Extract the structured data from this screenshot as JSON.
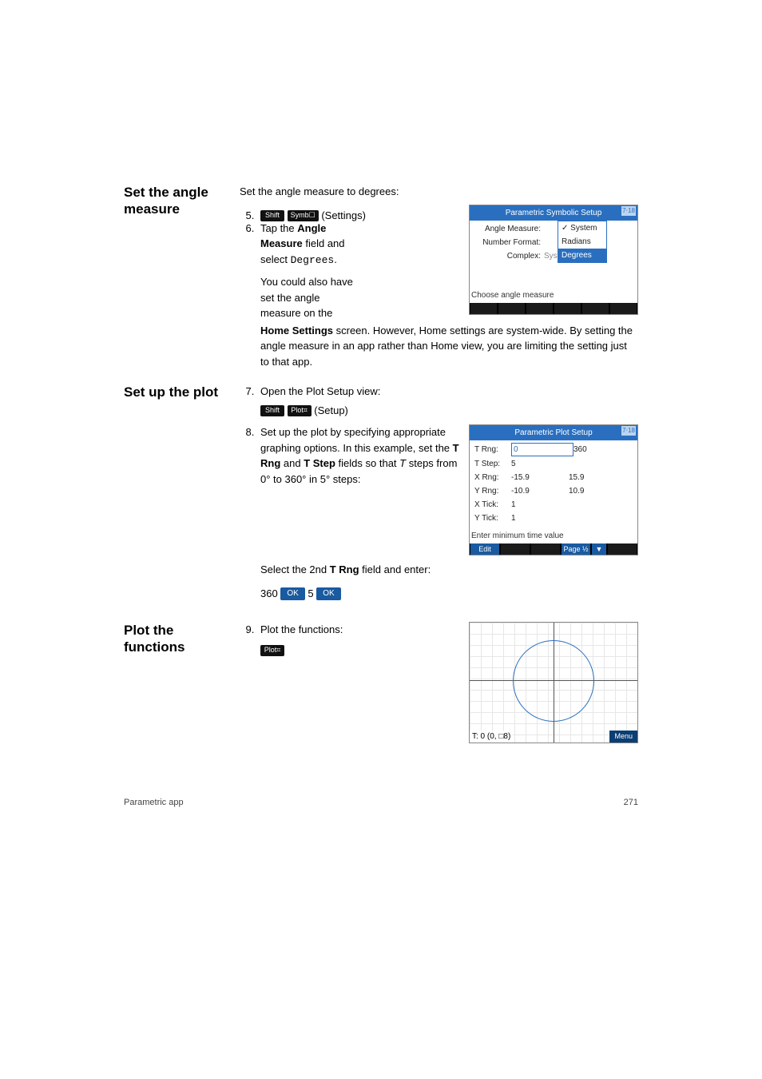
{
  "sections": {
    "angle": {
      "heading": "Set the angle measure",
      "intro": "Set the angle measure to degrees:",
      "step5": {
        "num": "5.",
        "label": "(Settings)",
        "key_shift": "Shift",
        "key_symb": "Symb☐"
      },
      "step6": {
        "num": "6.",
        "line1a": "Tap the ",
        "line1b": "Angle Measure",
        "line1c": " field and select ",
        "line1d": "Degrees",
        "line1e": ".",
        "para2a": "You could also have set the angle measure on the ",
        "para2b": "Home Settings",
        "para2c": " screen. However, Home settings are system-wide. By setting the angle measure in an app rather than Home view, you are limiting the setting just to that app."
      },
      "screenshot": {
        "title": "Parametric Symbolic Setup",
        "clock": "7⋅18",
        "rows": {
          "r1": "Angle Measure:",
          "r2": "Number Format:",
          "r3": "Complex:"
        },
        "dropdown": {
          "opt1": "System",
          "opt2": "Radians",
          "opt3": "Degrees"
        },
        "val_text": "System",
        "help": "Choose angle measure"
      }
    },
    "plot_setup": {
      "heading": "Set up the plot",
      "step7": {
        "num": "7.",
        "text": "Open the Plot Setup view:",
        "key_shift": "Shift",
        "key_plot": "Plot⌗",
        "label": "(Setup)"
      },
      "step8": {
        "num": "8.",
        "text_a": "Set up the plot by specifying appropriate graphing options. In this example, set the ",
        "text_b": "T Rng",
        "text_c": " and ",
        "text_d": "T Step",
        "text_e": " fields so that ",
        "text_f": "T",
        "text_g": " steps from 0° to 360° in 5° steps:",
        "select_a": "Select the 2nd ",
        "select_b": "T Rng",
        "select_c": " field ",
        "select_d": "and enter:",
        "entry_1": "360",
        "entry_ok": "OK",
        "entry_2": "5"
      },
      "screenshot": {
        "title": "Parametric Plot Setup",
        "clock": "7⋅18",
        "rows": {
          "r1l": "T Rng:",
          "r1v1": "0",
          "r1v2": "360",
          "r2l": "T Step:",
          "r2v1": "5",
          "r3l": "X Rng:",
          "r3v1": "-15.9",
          "r3v2": "15.9",
          "r4l": "Y Rng:",
          "r4v1": "-10.9",
          "r4v2": "10.9",
          "r5l": "X Tick:",
          "r5v1": "1",
          "r6l": "Y Tick:",
          "r6v1": "1"
        },
        "help": "Enter minimum time value",
        "sk_edit": "Edit",
        "sk_page": "Page ½",
        "sk_arrow": "▼"
      }
    },
    "plot_fn": {
      "heading": "Plot the functions",
      "step9": {
        "num": "9.",
        "text": "Plot the functions:",
        "key_plot": "Plot⌗"
      },
      "screenshot": {
        "status": "T: 0 (0, □8)",
        "menu": "Menu"
      }
    }
  },
  "footer": {
    "left": "Parametric app",
    "right": "271"
  }
}
